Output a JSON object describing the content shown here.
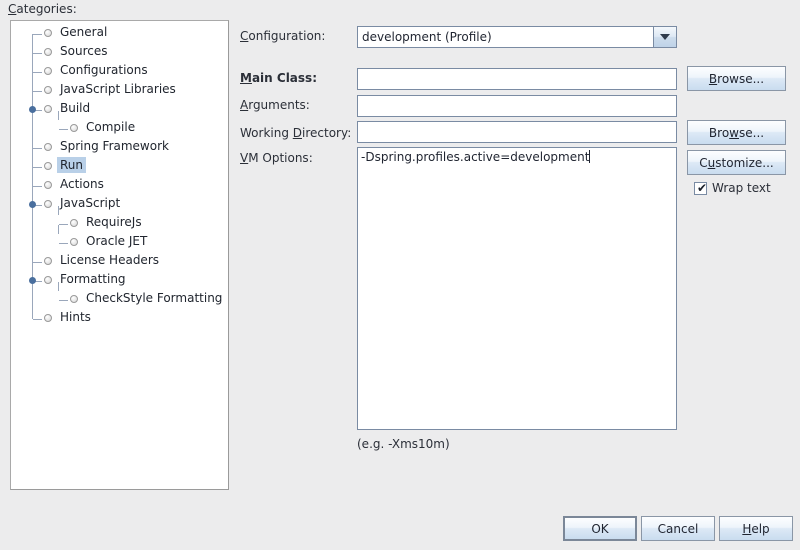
{
  "categories": {
    "label": "Categories:",
    "label_mnemonic": "C",
    "items": [
      {
        "label": "General",
        "depth": 1,
        "expandable": false,
        "selected": false
      },
      {
        "label": "Sources",
        "depth": 1,
        "expandable": false,
        "selected": false
      },
      {
        "label": "Configurations",
        "depth": 1,
        "expandable": false,
        "selected": false
      },
      {
        "label": "JavaScript Libraries",
        "depth": 1,
        "expandable": false,
        "selected": false
      },
      {
        "label": "Build",
        "depth": 1,
        "expandable": true,
        "selected": false
      },
      {
        "label": "Compile",
        "depth": 2,
        "expandable": false,
        "selected": false
      },
      {
        "label": "Spring Framework",
        "depth": 1,
        "expandable": false,
        "selected": false
      },
      {
        "label": "Run",
        "depth": 1,
        "expandable": false,
        "selected": true
      },
      {
        "label": "Actions",
        "depth": 1,
        "expandable": false,
        "selected": false
      },
      {
        "label": "JavaScript",
        "depth": 1,
        "expandable": true,
        "selected": false
      },
      {
        "label": "RequireJs",
        "depth": 2,
        "expandable": false,
        "selected": false
      },
      {
        "label": "Oracle JET",
        "depth": 2,
        "expandable": false,
        "selected": false
      },
      {
        "label": "License Headers",
        "depth": 1,
        "expandable": false,
        "selected": false
      },
      {
        "label": "Formatting",
        "depth": 1,
        "expandable": true,
        "selected": false
      },
      {
        "label": "CheckStyle Formatting",
        "depth": 2,
        "expandable": false,
        "selected": false
      },
      {
        "label": "Hints",
        "depth": 1,
        "expandable": false,
        "selected": false
      }
    ]
  },
  "form": {
    "configuration": {
      "label_pre": "",
      "label_mn": "C",
      "label_post": "onfiguration:",
      "value": "development (Profile)",
      "arrow_icon": "chevron-down-icon"
    },
    "main_class": {
      "label_pre": "",
      "label_mn": "M",
      "label_post": "ain Class:",
      "value": "",
      "placeholder": ""
    },
    "arguments": {
      "label_pre": "",
      "label_mn": "A",
      "label_post": "rguments:",
      "value": "",
      "placeholder": ""
    },
    "working_directory": {
      "label_pre": "Working ",
      "label_mn": "D",
      "label_post": "irectory:",
      "value": "",
      "placeholder": ""
    },
    "vm_options": {
      "label_pre": "",
      "label_mn": "V",
      "label_post": "M Options:",
      "value": "-Dspring.profiles.active=development",
      "hint": "(e.g. -Xms10m)"
    },
    "browse_main_class": {
      "pre": "",
      "mn": "B",
      "post": "rowse..."
    },
    "browse_working_dir": {
      "pre": "Bro",
      "mn": "w",
      "post": "se..."
    },
    "customize": {
      "pre": "C",
      "mn": "u",
      "post": "stomize..."
    },
    "wrap_text": {
      "label": "Wrap text",
      "checked": true,
      "tick": "✔"
    }
  },
  "dialog_buttons": {
    "ok": {
      "pre": "OK",
      "mn": "",
      "post": "",
      "default": true
    },
    "cancel": {
      "pre": "Cancel",
      "mn": "",
      "post": "",
      "default": false
    },
    "help": {
      "pre": "",
      "mn": "H",
      "post": "elp",
      "default": false
    }
  },
  "colors": {
    "dialog_background": "#ececed",
    "field_background": "#ffffff",
    "field_border": "#7a8ba3",
    "selection_highlight": "#b9d0e8",
    "button_gradient_top": "#fdfeff",
    "button_gradient_bottom": "#c9dcef",
    "text": "#1f2430"
  }
}
